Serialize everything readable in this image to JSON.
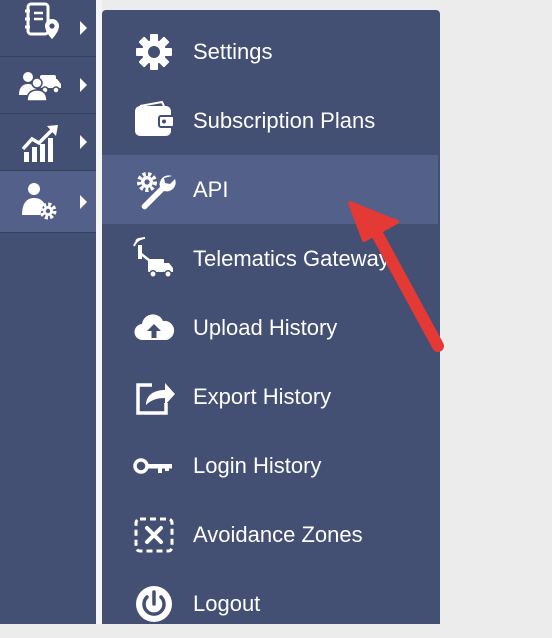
{
  "sidebar": {
    "items": [
      {
        "icon": "address-book-location-icon",
        "active": false
      },
      {
        "icon": "users-truck-icon",
        "active": false
      },
      {
        "icon": "analytics-chart-icon",
        "active": false
      },
      {
        "icon": "user-settings-icon",
        "active": true
      }
    ]
  },
  "menu": {
    "items": [
      {
        "label": "Settings",
        "icon": "gear-icon",
        "active": false
      },
      {
        "label": "Subscription Plans",
        "icon": "wallet-icon",
        "active": false
      },
      {
        "label": "API",
        "icon": "wrench-gear-icon",
        "active": true
      },
      {
        "label": "Telematics Gateway",
        "icon": "telematics-truck-icon",
        "active": false
      },
      {
        "label": "Upload History",
        "icon": "cloud-upload-icon",
        "active": false
      },
      {
        "label": "Export History",
        "icon": "export-share-icon",
        "active": false
      },
      {
        "label": "Login History",
        "icon": "key-icon",
        "active": false
      },
      {
        "label": "Avoidance Zones",
        "icon": "avoidance-zone-icon",
        "active": false
      },
      {
        "label": "Logout",
        "icon": "power-icon",
        "active": false
      }
    ]
  },
  "colors": {
    "panel": "#434f73",
    "active": "#52608a",
    "text": "#ffffff",
    "annotation_arrow": "#e53935"
  }
}
